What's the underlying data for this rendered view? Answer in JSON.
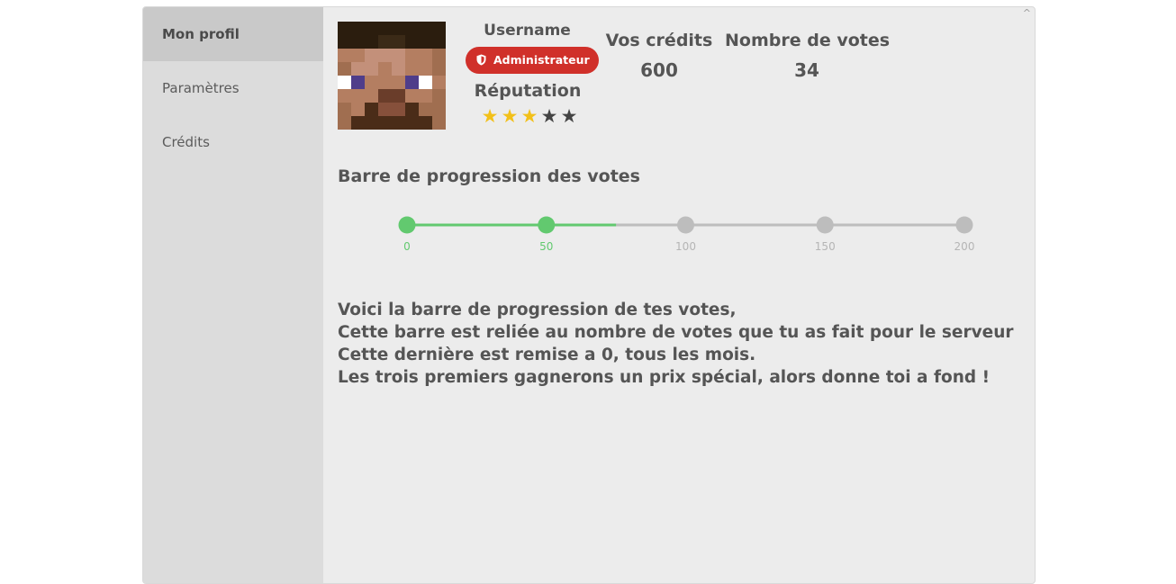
{
  "sidebar": {
    "items": [
      {
        "label": "Mon profil",
        "active": true
      },
      {
        "label": "Paramètres",
        "active": false
      },
      {
        "label": "Crédits",
        "active": false
      }
    ]
  },
  "scroll_icon": "chevron-up-icon",
  "profile": {
    "username": "Username",
    "role_badge": "Administrateur",
    "role_icon": "shield-icon",
    "reputation_label": "Réputation",
    "reputation_stars": 3,
    "reputation_max": 5
  },
  "stats": {
    "credits_label": "Vos crédits",
    "credits_value": "600",
    "votes_label": "Nombre de votes",
    "votes_value": "34"
  },
  "progress": {
    "title": "Barre de progression des votes",
    "current": 34,
    "milestones": [
      "0",
      "50",
      "100",
      "150",
      "200"
    ],
    "reached_milestones": 2,
    "fill_fraction": 0.375
  },
  "description": {
    "lines": [
      "Voici la barre de progression de tes votes,",
      "Cette barre est reliée au nombre de votes que tu as fait pour le serveur",
      "Cette dernière est remise a 0, tous les mois.",
      "Les trois premiers gagnerons un prix spécial, alors donne toi a fond !"
    ]
  },
  "colors": {
    "badge_bg": "#d0302a",
    "progress_active": "#62c96f",
    "progress_inactive": "#bdbdbd",
    "milestone_label_inactive": "#b5b5b5",
    "star_filled": "#f2c019",
    "star_empty": "#444444"
  }
}
